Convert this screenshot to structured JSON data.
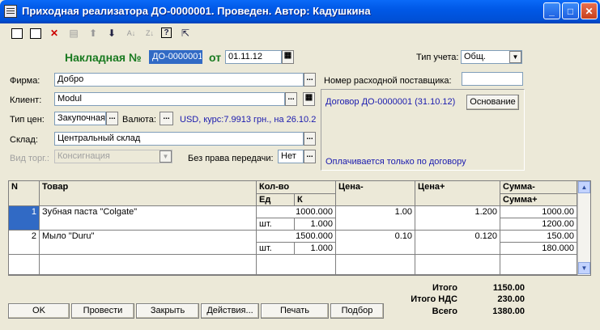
{
  "window": {
    "title": "Приходная реализатора ДО-0000001. Проведен. Автор: Кадушкина",
    "buttons": {
      "minimize": "_",
      "maximize": "□",
      "close": "✕"
    }
  },
  "toolbar": {
    "icons": [
      "new-doc-icon",
      "copy-doc-icon",
      "delete-doc-icon",
      "group-icon",
      "move-up-icon",
      "move-down-icon",
      "sort-asc-icon",
      "sort-desc-icon",
      "help-icon",
      "context-help-icon"
    ]
  },
  "header": {
    "invoice_label": "Накладная №",
    "invoice_number": "ДО-0000001",
    "date_label": "от",
    "date_value": "01.11.12",
    "accounting_type_label": "Тип учета:",
    "accounting_type_value": "Общ."
  },
  "form": {
    "firm_label": "Фирма:",
    "firm_value": "Добро",
    "client_label": "Клиент:",
    "client_value": "Modul",
    "price_type_label": "Тип цен:",
    "price_type_value": "Закупочная",
    "currency_label": "Валюта:",
    "currency_info": "USD, курс:7.9913 грн., на 26.10.2(",
    "warehouse_label": "Склад:",
    "warehouse_value": "Центральный склад",
    "trade_type_label": "Вид торг.:",
    "trade_type_value": "Консигнация",
    "no_transfer_label": "Без права передачи:",
    "no_transfer_value": "Нет",
    "supplier_no_label": "Номер расходной поставщика:",
    "supplier_no_value": "",
    "contract_text": "Договор ДО-0000001 (31.10.12)",
    "basis_button": "Основание",
    "payment_text": "Оплачивается только по договору"
  },
  "table": {
    "headers": {
      "n": "N",
      "product": "Товар",
      "qty": "Кол-во",
      "unit": "Ед",
      "k": "К",
      "price_minus": "Цена-",
      "price_plus": "Цена+",
      "sum_minus": "Сумма-",
      "sum_plus": "Сумма+"
    },
    "rows": [
      {
        "n": "1",
        "product": "Зубная паста \"Colgate\"",
        "qty": "1000.000",
        "unit": "шт.",
        "k": "1.000",
        "price_minus": "1.00",
        "price_plus": "1.200",
        "sum_minus": "1000.00",
        "sum_plus": "1200.00"
      },
      {
        "n": "2",
        "product": "Мыло \"Duru\"",
        "qty": "1500.000",
        "unit": "шт.",
        "k": "1.000",
        "price_minus": "0.10",
        "price_plus": "0.120",
        "sum_minus": "150.00",
        "sum_plus": "180.000"
      }
    ]
  },
  "totals": {
    "total_label": "Итого",
    "total_value": "1150.00",
    "vat_label": "Итого НДС",
    "vat_value": "230.00",
    "grand_label": "Всего",
    "grand_value": "1380.00"
  },
  "buttons": {
    "ok": "OK",
    "post": "Провести",
    "close": "Закрыть",
    "actions": "Действия...",
    "print": "Печать",
    "select": "Подбор"
  }
}
